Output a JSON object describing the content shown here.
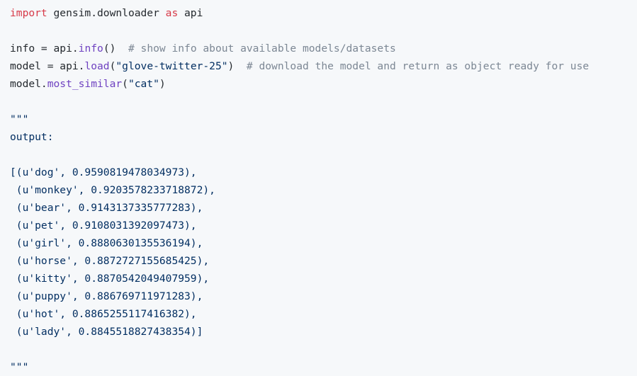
{
  "editor": {
    "language": "python",
    "background_color": "#f6f8fa",
    "default_text_color": "#24292e",
    "keyword_color": "#d73a49",
    "function_color": "#6f42c1",
    "string_color": "#032f62",
    "comment_color": "#7c8794"
  },
  "code": {
    "line1": {
      "kw_import": "import",
      "module": " gensim.downloader ",
      "kw_as": "as",
      "alias": " api"
    },
    "line3": {
      "var": "info = api.",
      "fn": "info",
      "parens": "()",
      "comment": "  # show info about available models/datasets"
    },
    "line4": {
      "var": "model = api.",
      "fn": "load",
      "open_paren": "(",
      "string": "\"glove-twitter-25\"",
      "close_paren": ")",
      "comment": "  # download the model and return as object ready for use"
    },
    "line5": {
      "var": "model.",
      "fn": "most_similar",
      "open_paren": "(",
      "string": "\"cat\"",
      "close_paren": ")"
    },
    "docstring_open": "\"\"\"",
    "docstring_label": "output:",
    "docstring_close": "\"\"\""
  },
  "output_lines": [
    "[(u'dog', 0.9590819478034973),",
    " (u'monkey', 0.9203578233718872),",
    " (u'bear', 0.9143137335777283),",
    " (u'pet', 0.9108031392097473),",
    " (u'girl', 0.8880630135536194),",
    " (u'horse', 0.8872727155685425),",
    " (u'kitty', 0.8870542049407959),",
    " (u'puppy', 0.886769711971283),",
    " (u'hot', 0.8865255117416382),",
    " (u'lady', 0.8845518827438354)]"
  ],
  "output_data": {
    "query_word": "cat",
    "model_name": "glove-twitter-25",
    "method": "most_similar",
    "results": [
      {
        "word": "dog",
        "similarity": 0.9590819478034973
      },
      {
        "word": "monkey",
        "similarity": 0.9203578233718872
      },
      {
        "word": "bear",
        "similarity": 0.9143137335777283
      },
      {
        "word": "pet",
        "similarity": 0.9108031392097473
      },
      {
        "word": "girl",
        "similarity": 0.8880630135536194
      },
      {
        "word": "horse",
        "similarity": 0.8872727155685425
      },
      {
        "word": "kitty",
        "similarity": 0.8870542049407959
      },
      {
        "word": "puppy",
        "similarity": 0.886769711971283
      },
      {
        "word": "hot",
        "similarity": 0.8865255117416382
      },
      {
        "word": "lady",
        "similarity": 0.8845518827438354
      }
    ]
  }
}
